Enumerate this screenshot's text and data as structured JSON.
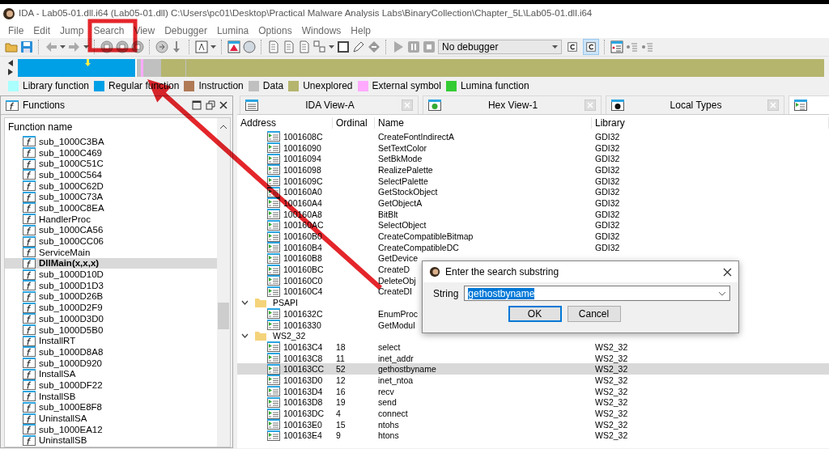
{
  "window": {
    "title": "IDA - Lab05-01.dll.i64 (Lab05-01.dll) C:\\Users\\pc01\\Desktop\\Practical Malware Analysis Labs\\BinaryCollection\\Chapter_5L\\Lab05-01.dll.i64"
  },
  "menu": [
    "File",
    "Edit",
    "Jump",
    "Search",
    "View",
    "Debugger",
    "Lumina",
    "Options",
    "Windows",
    "Help"
  ],
  "toolbar": {
    "debugger": "No debugger",
    "toggles": [
      {
        "pressed": false
      },
      {
        "pressed": true
      }
    ]
  },
  "legend": [
    {
      "label": "Library function",
      "color": "#aaffff"
    },
    {
      "label": "Regular function",
      "color": "#00a0e6"
    },
    {
      "label": "Instruction",
      "color": "#b07a55"
    },
    {
      "label": "Data",
      "color": "#c0c0c0"
    },
    {
      "label": "Unexplored",
      "color": "#b5b56e"
    },
    {
      "label": "External symbol",
      "color": "#ffaaff"
    },
    {
      "label": "Lumina function",
      "color": "#33cc33"
    }
  ],
  "functions_pane": {
    "title": "Functions",
    "column": "Function name",
    "items": [
      {
        "name": "sub_1000C3BA",
        "selected": false
      },
      {
        "name": "sub_1000C469",
        "selected": false
      },
      {
        "name": "sub_1000C51C",
        "selected": false
      },
      {
        "name": "sub_1000C564",
        "selected": false
      },
      {
        "name": "sub_1000C62D",
        "selected": false
      },
      {
        "name": "sub_1000C73A",
        "selected": false
      },
      {
        "name": "sub_1000C8EA",
        "selected": false
      },
      {
        "name": "HandlerProc",
        "selected": false
      },
      {
        "name": "sub_1000CA56",
        "selected": false
      },
      {
        "name": "sub_1000CC06",
        "selected": false
      },
      {
        "name": "ServiceMain",
        "selected": false
      },
      {
        "name": "DllMain(x,x,x)",
        "selected": true
      },
      {
        "name": "sub_1000D10D",
        "selected": false
      },
      {
        "name": "sub_1000D1D3",
        "selected": false
      },
      {
        "name": "sub_1000D26B",
        "selected": false
      },
      {
        "name": "sub_1000D2F9",
        "selected": false
      },
      {
        "name": "sub_1000D3D0",
        "selected": false
      },
      {
        "name": "sub_1000D5B0",
        "selected": false
      },
      {
        "name": "InstallRT",
        "selected": false
      },
      {
        "name": "sub_1000D8A8",
        "selected": false
      },
      {
        "name": "sub_1000D920",
        "selected": false
      },
      {
        "name": "InstallSA",
        "selected": false
      },
      {
        "name": "sub_1000DF22",
        "selected": false
      },
      {
        "name": "InstallSB",
        "selected": false
      },
      {
        "name": "sub_1000E8F8",
        "selected": false
      },
      {
        "name": "UninstallSA",
        "selected": false
      },
      {
        "name": "sub_1000EA12",
        "selected": false
      },
      {
        "name": "UninstallSB",
        "selected": false
      }
    ]
  },
  "tabs": [
    {
      "label": "IDA View-A",
      "selected": false
    },
    {
      "label": "Hex View-1",
      "selected": false
    },
    {
      "label": "Local Types",
      "selected": false
    },
    {
      "selected": true
    }
  ],
  "imports": {
    "columns": [
      "Address",
      "Ordinal",
      "Name",
      "Library"
    ],
    "groups": [
      {
        "children": [
          {
            "address": "1001608C",
            "name": "CreateFontIndirectA",
            "library": "GDI32",
            "selected": false
          },
          {
            "address": "10016090",
            "name": "SetTextColor",
            "library": "GDI32",
            "selected": false
          },
          {
            "address": "10016094",
            "name": "SetBkMode",
            "library": "GDI32",
            "selected": false
          },
          {
            "address": "10016098",
            "name": "RealizePalette",
            "library": "GDI32",
            "selected": false
          },
          {
            "address": "1001609C",
            "name": "SelectPalette",
            "library": "GDI32",
            "selected": false
          },
          {
            "address": "100160A0",
            "name": "GetStockObject",
            "library": "GDI32",
            "selected": false
          },
          {
            "address": "100160A4",
            "name": "GetObjectA",
            "library": "GDI32",
            "selected": false
          },
          {
            "address": "100160A8",
            "name": "BitBlt",
            "library": "GDI32",
            "selected": false
          },
          {
            "address": "100160AC",
            "name": "SelectObject",
            "library": "GDI32",
            "selected": false
          },
          {
            "address": "100160B0",
            "name": "CreateCompatibleBitmap",
            "library": "GDI32",
            "selected": false
          },
          {
            "address": "100160B4",
            "name": "CreateCompatibleDC",
            "library": "GDI32",
            "selected": false
          },
          {
            "address": "100160B8",
            "name": "GetDevice",
            "selected": false
          },
          {
            "address": "100160BC",
            "name": "CreateD",
            "selected": false
          },
          {
            "address": "100160C0",
            "name": "DeleteObj",
            "selected": false
          },
          {
            "address": "100160C4",
            "name": "CreateDI",
            "selected": false
          }
        ]
      },
      {
        "name": "PSAPI",
        "expanded": true,
        "children": [
          {
            "address": "1001632C",
            "name": "EnumProc",
            "selected": false
          },
          {
            "address": "10016330",
            "name": "GetModul",
            "selected": false
          }
        ]
      },
      {
        "name": "WS2_32",
        "expanded": true,
        "children": [
          {
            "address": "100163C4",
            "ordinal": "18",
            "name": "select",
            "library": "WS2_32",
            "selected": false
          },
          {
            "address": "100163C8",
            "ordinal": "11",
            "name": "inet_addr",
            "library": "WS2_32",
            "selected": false
          },
          {
            "address": "100163CC",
            "ordinal": "52",
            "name": "gethostbyname",
            "library": "WS2_32",
            "selected": true
          },
          {
            "address": "100163D0",
            "ordinal": "12",
            "name": "inet_ntoa",
            "library": "WS2_32",
            "selected": false
          },
          {
            "address": "100163D4",
            "ordinal": "16",
            "name": "recv",
            "library": "WS2_32",
            "selected": false
          },
          {
            "address": "100163D8",
            "ordinal": "19",
            "name": "send",
            "library": "WS2_32",
            "selected": false
          },
          {
            "address": "100163DC",
            "ordinal": "4",
            "name": "connect",
            "library": "WS2_32",
            "selected": false
          },
          {
            "address": "100163E0",
            "ordinal": "15",
            "name": "ntohs",
            "library": "WS2_32",
            "selected": false
          },
          {
            "address": "100163E4",
            "ordinal": "9",
            "name": "htons",
            "library": "WS2_32",
            "selected": false
          }
        ]
      }
    ]
  },
  "dialog": {
    "title": "Enter the search substring",
    "label": "String",
    "value": "gethostbyname",
    "buttons": [
      {
        "label": "OK",
        "default": true
      },
      {
        "label": "Cancel",
        "default": false
      }
    ]
  }
}
